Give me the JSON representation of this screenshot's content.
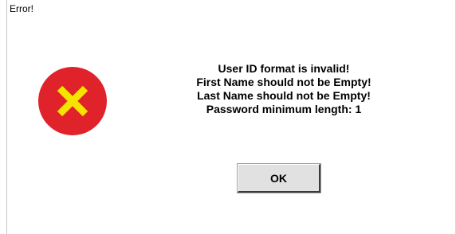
{
  "window": {
    "title": "Error!"
  },
  "icon": {
    "name": "error-icon",
    "circle_color": "#e0232b",
    "cross_color": "#f4e400"
  },
  "message": {
    "lines": [
      "User ID format is invalid!",
      "First Name should not be Empty!",
      "Last Name should not be Empty!",
      "Password minimum length: 1"
    ]
  },
  "buttons": {
    "ok_label": "OK"
  }
}
